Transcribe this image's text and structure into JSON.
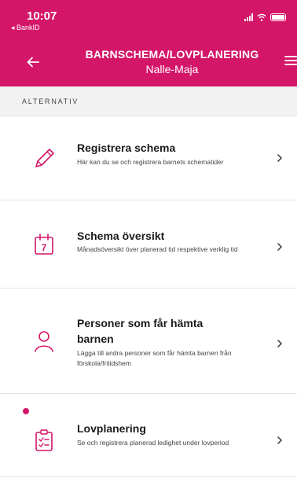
{
  "colors": {
    "brand": "#d41669",
    "text": "#1b1b1b"
  },
  "status_bar": {
    "time": "10:07",
    "back_app": "◂ BankID",
    "icons": [
      "signal-icon",
      "wifi-icon",
      "battery-icon"
    ]
  },
  "nav": {
    "title": "BARNSCHEMA/LOVPLANERING",
    "subtitle": "Nalle-Maja",
    "back_icon": "back-arrow-icon",
    "menu_icon": "menu-icon"
  },
  "section": {
    "label": "ALTERNATIV"
  },
  "items": [
    {
      "title": "Registrera schema",
      "description": "Här kan du se och registrera barnets schematider",
      "icon": "pencil-icon",
      "unread": false
    },
    {
      "title": "Schema översikt",
      "description": "Månadsöversikt över planerad tid respektive verklig tid",
      "icon": "calendar-icon",
      "icon_text": "7",
      "unread": false
    },
    {
      "title": "Personer som får hämta barnen",
      "description": "Lägga till andra personer som får hämta barnen från förskola/fritidshem",
      "icon": "person-icon",
      "unread": false
    },
    {
      "title": "Lovplanering",
      "description": "Se och registrera planerad ledighet under lovperiod",
      "icon": "clipboard-icon",
      "unread": true
    }
  ]
}
